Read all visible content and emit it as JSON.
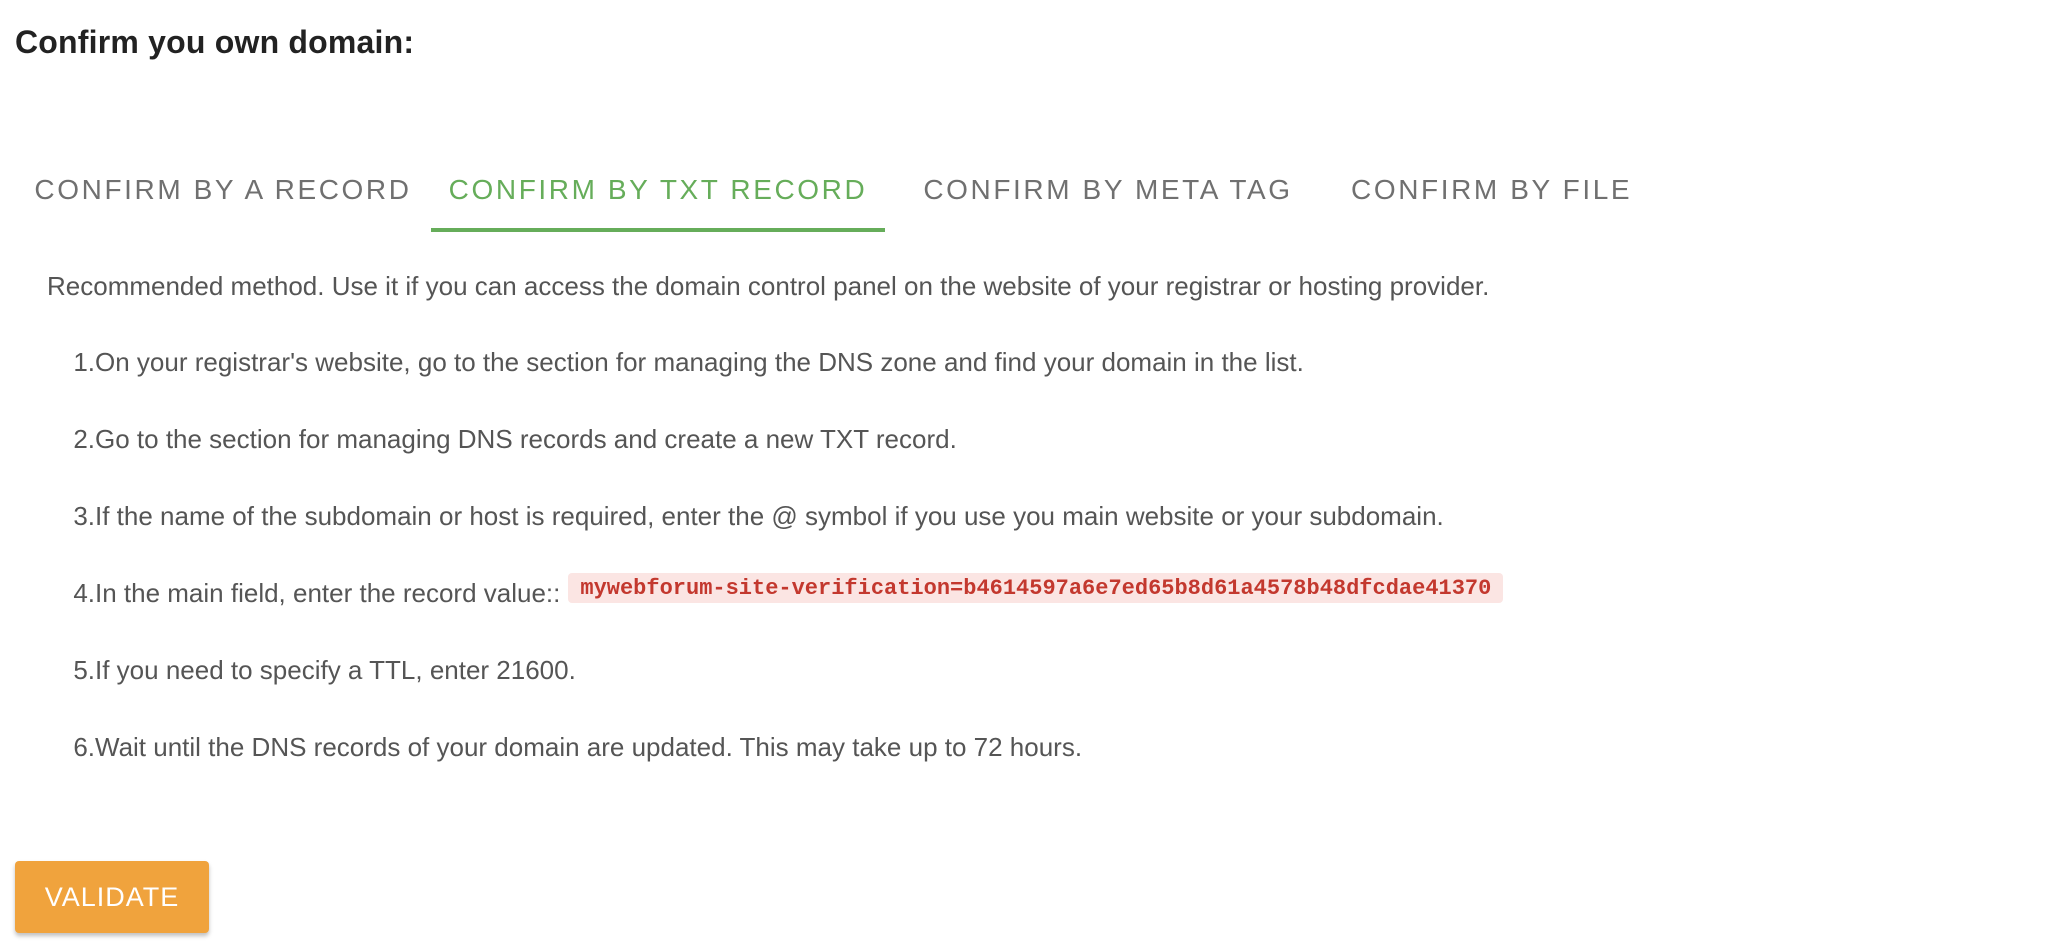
{
  "page": {
    "title": "Confirm you own domain:"
  },
  "tabs": [
    {
      "label": "CONFIRM BY A RECORD",
      "active": false
    },
    {
      "label": "CONFIRM BY TXT RECORD",
      "active": true
    },
    {
      "label": "CONFIRM BY META TAG",
      "active": false
    },
    {
      "label": "CONFIRM BY FILE",
      "active": false
    }
  ],
  "content": {
    "intro": "Recommended method. Use it if you can access the domain control panel on the website of your registrar or hosting provider.",
    "steps": [
      {
        "num": "1.",
        "text": "On your registrar's website, go to the section for managing the DNS zone and find your domain in the list."
      },
      {
        "num": "2.",
        "text": "Go to the section for managing DNS records and create a new TXT record."
      },
      {
        "num": "3.",
        "text": "If the name of the subdomain or host is required, enter the @ symbol if you use you main website or your subdomain."
      },
      {
        "num": "4.",
        "text": "In the main field, enter the record value::",
        "code": "mywebforum-site-verification=b4614597a6e7ed65b8d61a4578b48dfcdae41370"
      },
      {
        "num": "5.",
        "text": "If you need to specify a TTL, enter 21600."
      },
      {
        "num": "6.",
        "text": "Wait until the DNS records of your domain are updated. This may take up to 72 hours."
      }
    ]
  },
  "actions": {
    "validate_label": "VALIDATE"
  },
  "colors": {
    "accent_green": "#66ad5a",
    "validate_orange": "#f0a33d",
    "code_text": "#c3382e",
    "code_bg": "#fbe5e3"
  }
}
